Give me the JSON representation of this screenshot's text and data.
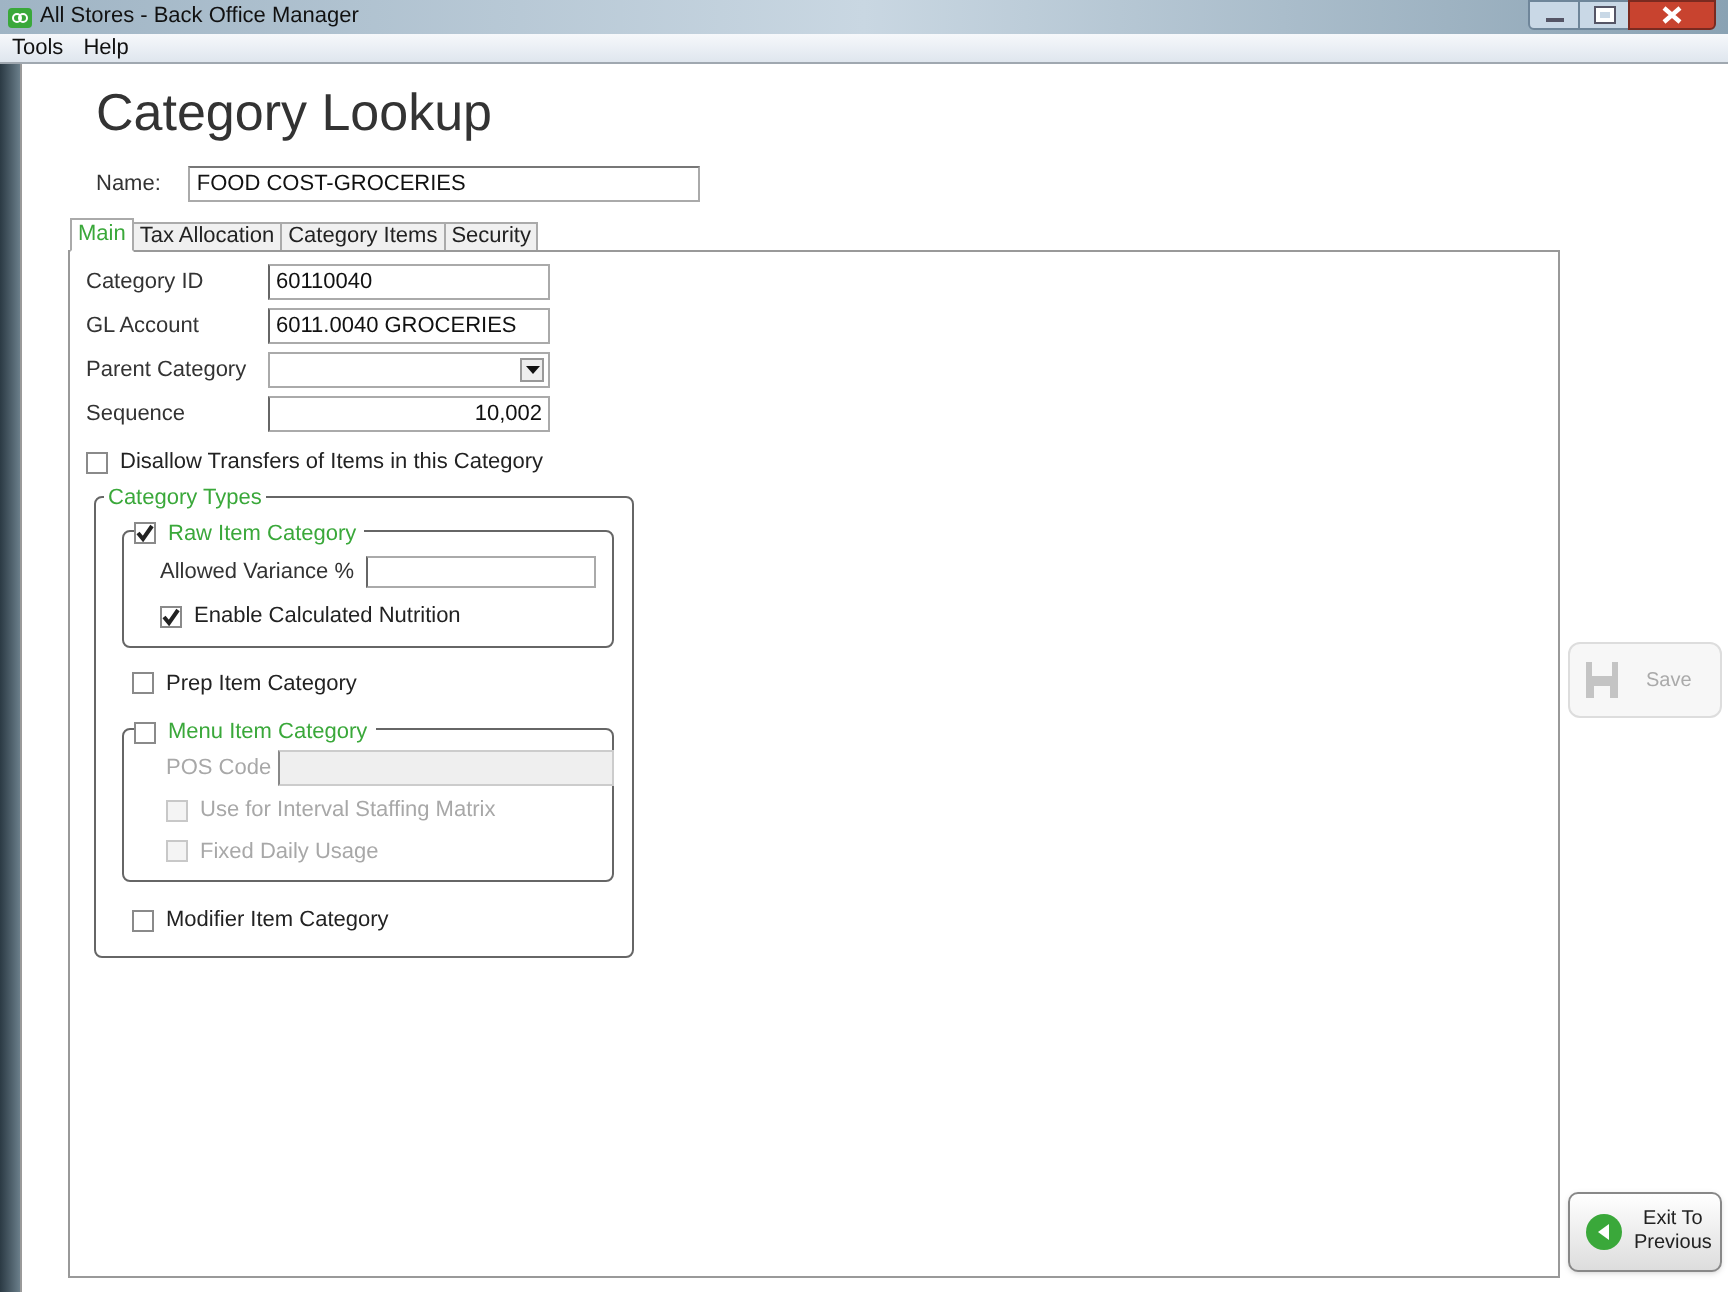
{
  "window": {
    "title": "All Stores - Back Office Manager"
  },
  "menu": [
    "Tools",
    "Help"
  ],
  "heading": "Category Lookup",
  "name_field": {
    "label": "Name:",
    "value": "FOOD COST-GROCERIES"
  },
  "tabs": [
    {
      "label": "Main",
      "selected": true
    },
    {
      "label": "Tax Allocation",
      "selected": false
    },
    {
      "label": "Category Items",
      "selected": false
    },
    {
      "label": "Security",
      "selected": false
    }
  ],
  "fields": [
    {
      "label": "Category ID",
      "kind": "text",
      "value": "60110040"
    },
    {
      "label": "GL Account",
      "kind": "text",
      "value": "6011.0040 GROCERIES"
    },
    {
      "label": "Parent Category",
      "kind": "dropdown"
    },
    {
      "label": "Sequence",
      "kind": "number",
      "value": "10,002"
    }
  ],
  "disallow_transfers": {
    "label": "Disallow Transfers of Items in this Category",
    "checked": false
  },
  "category_types": {
    "title": "Category Types",
    "raw": {
      "label": "Raw Item Category",
      "checked": true,
      "variance_label": "Allowed Variance %",
      "nutrition": {
        "label": "Enable Calculated Nutrition",
        "checked": true
      }
    },
    "prep": {
      "label": "Prep Item Category",
      "checked": false
    },
    "menu_item": {
      "label": "Menu Item Category",
      "checked": false,
      "pos_label": "POS Code",
      "options": [
        {
          "label": "Use for Interval Staffing Matrix",
          "checked": false,
          "disabled": true
        },
        {
          "label": "Fixed Daily Usage",
          "checked": false,
          "disabled": true
        }
      ]
    },
    "modifier": {
      "label": "Modifier Item Category",
      "checked": false
    }
  },
  "save_button": {
    "label": "Save",
    "disabled": true
  },
  "exit_button": {
    "label_1": "Exit To",
    "label_2": "Previous"
  }
}
